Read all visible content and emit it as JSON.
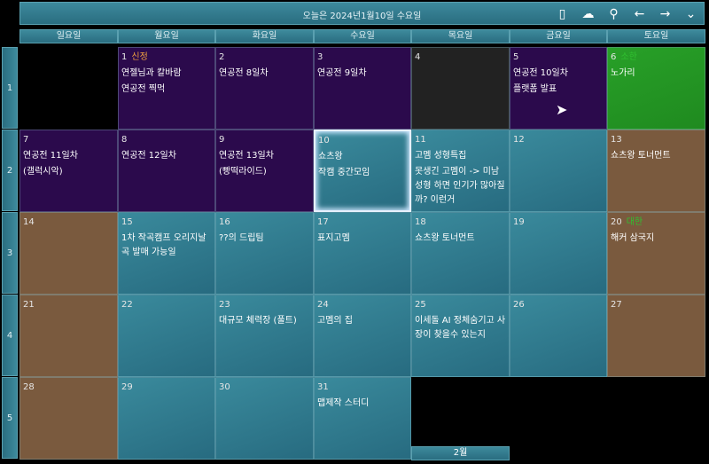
{
  "header": {
    "title": "오늘은 2024년1월10일 수요일",
    "icons": [
      "phone-icon",
      "cloud-check-icon",
      "user-icon",
      "arrow-left-icon",
      "arrow-right-icon",
      "chevron-down-icon"
    ]
  },
  "weekdays": [
    "일요일",
    "월요일",
    "화요일",
    "수요일",
    "목요일",
    "금요일",
    "토요일"
  ],
  "weeks": [
    "1",
    "2",
    "3",
    "4",
    "5"
  ],
  "colors": {
    "teal": "#2e7a8c",
    "purple": "#2b0a4c",
    "green": "#229022",
    "brown": "#7a5a3e",
    "holiday_orange": "#f0a040",
    "holiday_green": "#30c030"
  },
  "days": [
    {
      "num": "",
      "style": "black",
      "events": []
    },
    {
      "num": "1",
      "holiday": "신정",
      "holiday_color": "#f0a040",
      "style": "purple",
      "events": [
        "연젤님과 칼바람",
        "연공전 찍먹"
      ]
    },
    {
      "num": "2",
      "style": "purple",
      "events": [
        "연공전 8일차"
      ]
    },
    {
      "num": "3",
      "style": "purple",
      "events": [
        "연공전 9일차"
      ]
    },
    {
      "num": "4",
      "style": "dark",
      "events": []
    },
    {
      "num": "5",
      "style": "purple",
      "events": [
        "연공전 10일차",
        "플랫폼 발표"
      ]
    },
    {
      "num": "6",
      "holiday": "소한",
      "holiday_color": "#30c030",
      "style": "green",
      "events": [
        "노가리"
      ]
    },
    {
      "num": "7",
      "style": "purple",
      "events": [
        "연공전 11일차",
        "(갤럭시악)"
      ]
    },
    {
      "num": "8",
      "style": "purple",
      "events": [
        "연공전 12일차"
      ]
    },
    {
      "num": "9",
      "style": "purple",
      "events": [
        "연공전 13일차",
        "(빵떡라이드)"
      ]
    },
    {
      "num": "10",
      "style": "teal",
      "today": true,
      "events": [
        "쇼츠왕",
        "작캠 중간모임"
      ]
    },
    {
      "num": "11",
      "style": "teal",
      "events": [
        "고멤 성형특집",
        "못생긴 고멤이 -> 미남성형 하면 인기가 많아질까? 이런거"
      ]
    },
    {
      "num": "12",
      "style": "teal",
      "events": []
    },
    {
      "num": "13",
      "style": "brown",
      "events": [
        "쇼츠왕 토너먼트"
      ]
    },
    {
      "num": "14",
      "style": "brown",
      "events": []
    },
    {
      "num": "15",
      "style": "teal",
      "events": [
        "1차 작곡캠프 오리지날곡 발매 가능일"
      ]
    },
    {
      "num": "16",
      "style": "teal",
      "events": [
        "??의 드립팀"
      ]
    },
    {
      "num": "17",
      "style": "teal",
      "events": [
        "표지고멤"
      ]
    },
    {
      "num": "18",
      "style": "teal",
      "events": [
        "쇼츠왕 토너먼트"
      ]
    },
    {
      "num": "19",
      "style": "teal",
      "events": []
    },
    {
      "num": "20",
      "holiday": "대한",
      "holiday_color": "#30c030",
      "style": "brown",
      "events": [
        "해커 삼국지"
      ]
    },
    {
      "num": "21",
      "style": "brown",
      "events": []
    },
    {
      "num": "22",
      "style": "teal",
      "events": []
    },
    {
      "num": "23",
      "style": "teal",
      "events": [
        "대규모 체력장 (풀트)"
      ]
    },
    {
      "num": "24",
      "style": "teal",
      "events": [
        "고멤의 집"
      ]
    },
    {
      "num": "25",
      "style": "teal",
      "events": [
        "이세돌 AI 정체숨기고 사장이 찾을수 있는지"
      ]
    },
    {
      "num": "26",
      "style": "teal",
      "events": []
    },
    {
      "num": "27",
      "style": "brown",
      "events": []
    },
    {
      "num": "28",
      "style": "brown",
      "events": []
    },
    {
      "num": "29",
      "style": "teal",
      "events": []
    },
    {
      "num": "30",
      "style": "teal",
      "events": []
    },
    {
      "num": "31",
      "style": "teal",
      "events": [
        "맵제작 스터디"
      ]
    },
    {
      "num": "",
      "style": "black",
      "events": []
    },
    {
      "num": "",
      "style": "black",
      "events": []
    },
    {
      "num": "",
      "style": "black",
      "events": []
    }
  ],
  "next_month_label": "2월"
}
